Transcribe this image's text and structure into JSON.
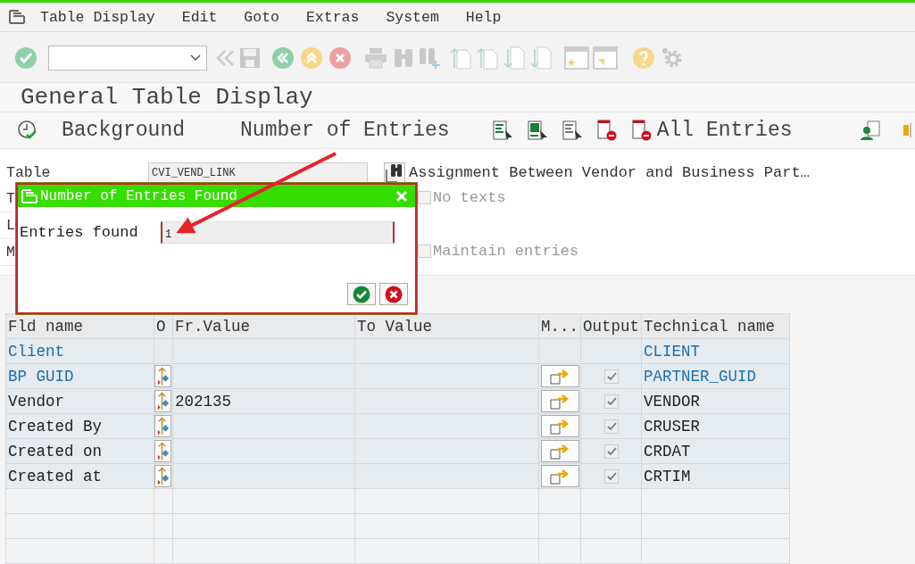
{
  "menu": [
    {
      "label": "Table Display"
    },
    {
      "label": "Edit"
    },
    {
      "label": "Goto"
    },
    {
      "label": "Extras"
    },
    {
      "label": "System"
    },
    {
      "label": "Help"
    }
  ],
  "screen_title": "General Table Display",
  "app_toolbar": [
    {
      "kind": "icon"
    },
    {
      "kind": "text",
      "label": "Background"
    },
    {
      "kind": "text",
      "label": "Number of Entries"
    },
    {
      "kind": "icon"
    },
    {
      "kind": "icon"
    },
    {
      "kind": "icon"
    },
    {
      "kind": "icon"
    },
    {
      "kind": "icon"
    },
    {
      "kind": "text",
      "label": "All Entries"
    }
  ],
  "form": [
    {
      "kind": "field",
      "label": "Table",
      "value": "CVI_VEND_LINK",
      "description": "Assignment Between Vendor and Business Part…"
    },
    {
      "kind": "checkbox",
      "label": "T",
      "option": "No texts",
      "checked": false
    },
    {
      "kind": "plain",
      "label": "L"
    },
    {
      "kind": "checkbox",
      "label": "M",
      "option": "Maintain entries",
      "checked": false
    }
  ],
  "table": {
    "columns": [
      "Fld name",
      "O",
      "Fr.Value",
      "To Value",
      "M...",
      "Output",
      "Technical name"
    ],
    "rows": [
      {
        "kind": "fixed",
        "key": true,
        "name": "Client",
        "technical": "CLIENT"
      },
      {
        "kind": "field",
        "key": true,
        "name": "BP GUID",
        "output": true,
        "technical": "PARTNER_GUID"
      },
      {
        "kind": "field",
        "key": false,
        "name": "Vendor",
        "from": "202135",
        "output": true,
        "technical": "VENDOR"
      },
      {
        "kind": "field",
        "key": false,
        "name": "Created By",
        "output": true,
        "technical": "CRUSER"
      },
      {
        "kind": "field",
        "key": false,
        "name": "Created on",
        "output": true,
        "technical": "CRDAT"
      },
      {
        "kind": "field",
        "key": false,
        "name": "Created at",
        "output": true,
        "technical": "CRTIM"
      }
    ]
  },
  "dialog": {
    "title": "Number of Entries Found",
    "label": "Entries found",
    "value": "1"
  }
}
